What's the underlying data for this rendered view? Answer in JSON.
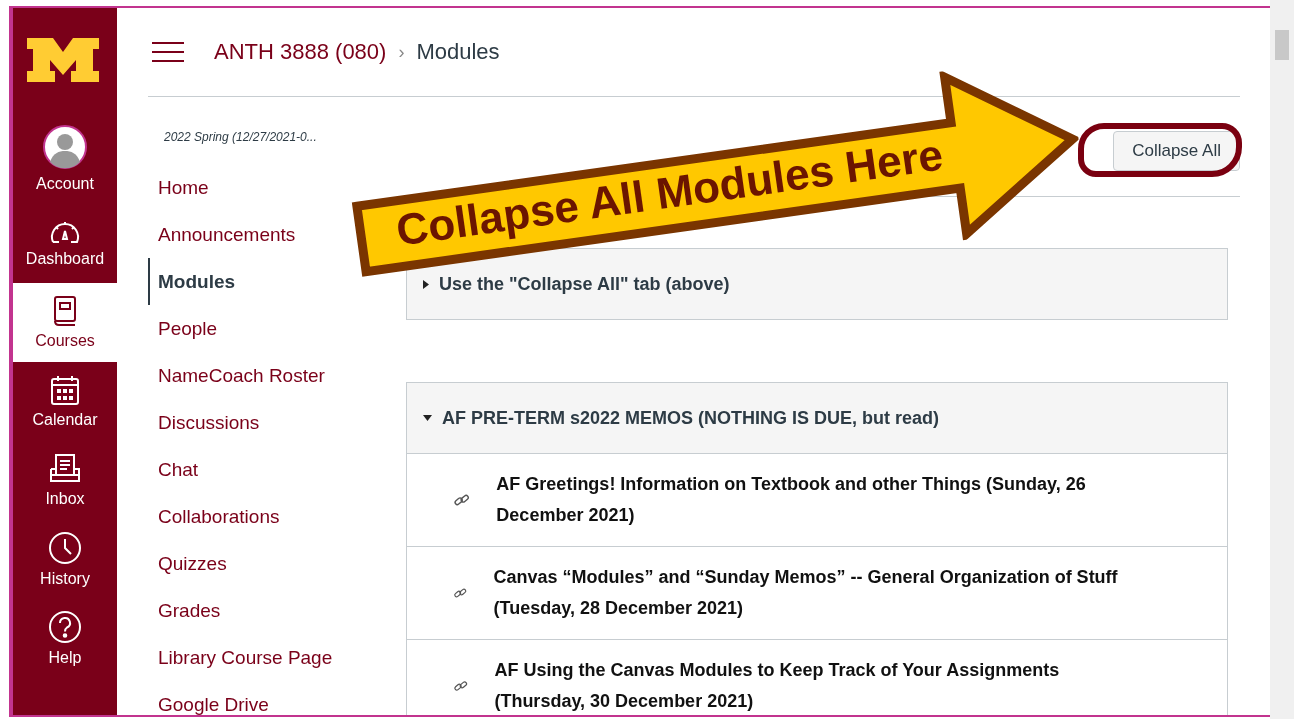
{
  "global_nav": [
    {
      "kind": "account",
      "label": "Account",
      "selected": false
    },
    {
      "kind": "dashboard",
      "label": "Dashboard",
      "selected": false
    },
    {
      "kind": "courses",
      "label": "Courses",
      "selected": true
    },
    {
      "kind": "calendar",
      "label": "Calendar",
      "selected": false
    },
    {
      "kind": "inbox",
      "label": "Inbox",
      "selected": false
    },
    {
      "kind": "history",
      "label": "History",
      "selected": false
    },
    {
      "kind": "help",
      "label": "Help",
      "selected": false
    }
  ],
  "breadcrumb": {
    "course": "ANTH 3888 (080)",
    "separator": "›",
    "page": "Modules"
  },
  "term": "2022 Spring (12/27/2021-0...",
  "course_nav": [
    {
      "label": "Home",
      "selected": false
    },
    {
      "label": "Announcements",
      "selected": false
    },
    {
      "label": "Modules",
      "selected": true
    },
    {
      "label": "People",
      "selected": false
    },
    {
      "label": "NameCoach Roster",
      "selected": false
    },
    {
      "label": "Discussions",
      "selected": false
    },
    {
      "label": "Chat",
      "selected": false
    },
    {
      "label": "Collaborations",
      "selected": false
    },
    {
      "label": "Quizzes",
      "selected": false
    },
    {
      "label": "Grades",
      "selected": false
    },
    {
      "label": "Library Course Page",
      "selected": false
    },
    {
      "label": "Google Drive",
      "selected": false
    }
  ],
  "collapse_button": "Collapse All",
  "callout": "Collapse All Modules Here",
  "modules": [
    {
      "title": "Use the \"Collapse All\" tab (above)",
      "expanded": false
    },
    {
      "title": "AF PRE-TERM s2022 MEMOS (NOTHING IS DUE, but read)",
      "expanded": true,
      "items": [
        {
          "title": "AF Greetings! Information on Textbook and other Things (Sunday, 26 December 2021)"
        },
        {
          "title": "Canvas “Modules” and “Sunday Memos” -- General Organization of Stuff (Tuesday, 28 December 2021)"
        },
        {
          "title": "AF Using the Canvas Modules to Keep Track of Your Assignments (Thursday, 30 December 2021)"
        }
      ]
    }
  ]
}
